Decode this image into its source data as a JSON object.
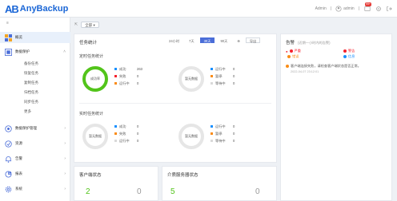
{
  "brand": {
    "mark": "AB",
    "name": "AnyBackup"
  },
  "topbar": {
    "user": "Admin",
    "user_label": "admin",
    "notice_count": "99+"
  },
  "sidebar": {
    "collapse_label": "≡",
    "items": [
      {
        "label": "概览",
        "icon": "dashboard-icon",
        "active": true
      },
      {
        "label": "数据保护",
        "icon": "protection-icon",
        "arrow": "˄"
      },
      {
        "label": "数据保护管理",
        "icon": "storage-icon",
        "arrow": "›"
      },
      {
        "label": "资源",
        "icon": "resource-icon",
        "arrow": "›"
      },
      {
        "label": "告警",
        "icon": "alert-icon",
        "arrow": "›"
      },
      {
        "label": "报表",
        "icon": "report-icon",
        "arrow": "›"
      },
      {
        "label": "系统",
        "icon": "settings-icon",
        "arrow": "›"
      }
    ],
    "subitems": [
      "备份任务",
      "恢复任务",
      "复制任务",
      "归档任务",
      "同步任务",
      "更多"
    ]
  },
  "crumb": {
    "icon": "⇱",
    "select": "全部 ▾"
  },
  "jobs": {
    "title": "任务统计",
    "filters": [
      "24小时",
      "7天",
      "30天",
      "90天",
      "⊕",
      "导出"
    ],
    "active_filter": 2,
    "section1": "定时任务统计",
    "section2": "实时任务统计",
    "ring1_label": "成功率",
    "ring2_label": "暂无数据",
    "ring3_label": "暂无数据",
    "ring4_label": "暂无数据",
    "legend_a": [
      {
        "name": "成功",
        "value": "263",
        "color": "#1890ff"
      },
      {
        "name": "失败",
        "value": "0",
        "color": "#f5222d"
      },
      {
        "name": "运行中",
        "value": "0",
        "color": "#fa8c16"
      }
    ],
    "legend_b": [
      {
        "name": "运行中",
        "value": "0",
        "color": "#1890ff"
      },
      {
        "name": "暂停",
        "value": "0",
        "color": "#fa8c16"
      },
      {
        "name": "等待中",
        "value": "0",
        "color": "#d9d9d9"
      }
    ],
    "legend_c": [
      {
        "name": "成功",
        "value": "0",
        "color": "#1890ff"
      },
      {
        "name": "失败",
        "value": "0",
        "color": "#fa8c16"
      },
      {
        "name": "运行中",
        "value": "0",
        "color": "#d9d9d9"
      }
    ],
    "legend_d": [
      {
        "name": "运行中",
        "value": "0",
        "color": "#1890ff"
      },
      {
        "name": "暂停",
        "value": "0",
        "color": "#fa8c16"
      },
      {
        "name": "等待中",
        "value": "0",
        "color": "#d9d9d9"
      }
    ]
  },
  "alerts": {
    "title": "告警",
    "subtitle": "(近期一小时内的告警)",
    "rows": [
      {
        "label": "严重",
        "color": "#f5222d"
      },
      {
        "label": "警告",
        "color": "#f5222d"
      },
      {
        "label": "错误",
        "color": "#fa8c16"
      },
      {
        "label": "信息",
        "color": "#1890ff"
      }
    ],
    "message": "客户端连接失败，请检查客户端状态是否正常。",
    "time": "2022-04-07 23:12:01"
  },
  "stat1": {
    "title": "客户端状态",
    "left": "2",
    "right": "0"
  },
  "stat2": {
    "title": "介质服务器状态",
    "left": "5",
    "right": "0"
  }
}
